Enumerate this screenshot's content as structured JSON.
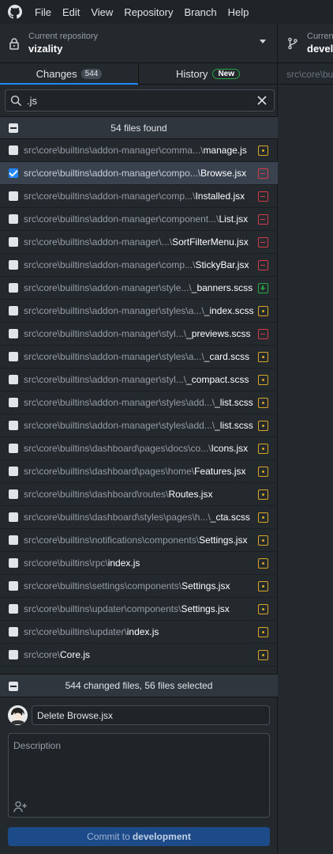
{
  "menu": [
    "File",
    "Edit",
    "View",
    "Repository",
    "Branch",
    "Help"
  ],
  "repo": {
    "label": "Current repository",
    "name": "vizality"
  },
  "branch": {
    "label": "Current branch",
    "name": "development"
  },
  "tabs": {
    "changes_label": "Changes",
    "changes_count": "544",
    "history_label": "History",
    "history_badge": "New"
  },
  "filter": {
    "value": ".js"
  },
  "found_text": "54 files found",
  "files": [
    {
      "dir": "src\\core\\builtins\\addon-manager\\comma...\\",
      "file": "manage.js",
      "status": "mod",
      "checked": false
    },
    {
      "dir": "src\\core\\builtins\\addon-manager\\compo...\\",
      "file": "Browse.jsx",
      "status": "del",
      "checked": true
    },
    {
      "dir": "src\\core\\builtins\\addon-manager\\comp...\\",
      "file": "Installed.jsx",
      "status": "del",
      "checked": false
    },
    {
      "dir": "src\\core\\builtins\\addon-manager\\component...\\",
      "file": "List.jsx",
      "status": "del",
      "checked": false
    },
    {
      "dir": "src\\core\\builtins\\addon-manager\\...\\",
      "file": "SortFilterMenu.jsx",
      "status": "del",
      "checked": false
    },
    {
      "dir": "src\\core\\builtins\\addon-manager\\comp...\\",
      "file": "StickyBar.jsx",
      "status": "del",
      "checked": false
    },
    {
      "dir": "src\\core\\builtins\\addon-manager\\style...\\",
      "file": "_banners.scss",
      "status": "add",
      "checked": false
    },
    {
      "dir": "src\\core\\builtins\\addon-manager\\styles\\a...\\",
      "file": "_index.scss",
      "status": "mod",
      "checked": false
    },
    {
      "dir": "src\\core\\builtins\\addon-manager\\styl...\\",
      "file": "_previews.scss",
      "status": "del",
      "checked": false
    },
    {
      "dir": "src\\core\\builtins\\addon-manager\\styles\\a...\\",
      "file": "_card.scss",
      "status": "mod",
      "checked": false
    },
    {
      "dir": "src\\core\\builtins\\addon-manager\\styl...\\",
      "file": "_compact.scss",
      "status": "mod",
      "checked": false
    },
    {
      "dir": "src\\core\\builtins\\addon-manager\\styles\\add...\\",
      "file": "_list.scss",
      "status": "mod",
      "checked": false
    },
    {
      "dir": "src\\core\\builtins\\addon-manager\\styles\\add...\\",
      "file": "_list.scss",
      "status": "mod",
      "checked": false
    },
    {
      "dir": "src\\core\\builtins\\dashboard\\pages\\docs\\co...\\",
      "file": "Icons.jsx",
      "status": "mod",
      "checked": false
    },
    {
      "dir": "src\\core\\builtins\\dashboard\\pages\\home\\",
      "file": "Features.jsx",
      "status": "mod",
      "checked": false
    },
    {
      "dir": "src\\core\\builtins\\dashboard\\routes\\",
      "file": "Routes.jsx",
      "status": "mod",
      "checked": false
    },
    {
      "dir": "src\\core\\builtins\\dashboard\\styles\\pages\\h...\\",
      "file": "_cta.scss",
      "status": "mod",
      "checked": false
    },
    {
      "dir": "src\\core\\builtins\\notifications\\components\\",
      "file": "Settings.jsx",
      "status": "mod",
      "checked": false
    },
    {
      "dir": "src\\core\\builtins\\rpc\\",
      "file": "index.js",
      "status": "mod",
      "checked": false
    },
    {
      "dir": "src\\core\\builtins\\settings\\components\\",
      "file": "Settings.jsx",
      "status": "mod",
      "checked": false
    },
    {
      "dir": "src\\core\\builtins\\updater\\components\\",
      "file": "Settings.jsx",
      "status": "mod",
      "checked": false
    },
    {
      "dir": "src\\core\\builtins\\updater\\",
      "file": "index.js",
      "status": "mod",
      "checked": false
    },
    {
      "dir": "src\\core\\",
      "file": "Core.js",
      "status": "mod",
      "checked": false
    }
  ],
  "summary_text": "544 changed files, 56 files selected",
  "commit": {
    "summary_value": "Delete Browse.jsx",
    "description_placeholder": "Description",
    "button_prefix": "Commit to",
    "button_branch": "development"
  },
  "right_path": "src\\core\\builtins\\addon-manager\\components\\Browse.jsx",
  "colors": {
    "modified": "#d8a526",
    "deleted": "#d73a49",
    "added": "#28a745",
    "accent": "#2188ff"
  }
}
